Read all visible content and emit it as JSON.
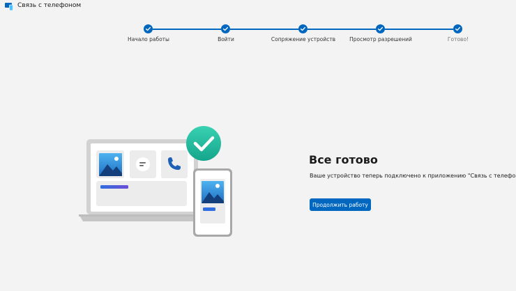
{
  "app": {
    "title": "Связь с телефоном"
  },
  "steps": [
    {
      "label": "Начало работы"
    },
    {
      "label": "Войти"
    },
    {
      "label": "Сопряжение устройств"
    },
    {
      "label": "Просмотр разрешений"
    },
    {
      "label": "Готово!"
    }
  ],
  "main": {
    "heading": "Все готово",
    "description": "Ваше устройство теперь подключено к приложению \"Связь с телефоном\".",
    "continue_label": "Продолжить работу"
  },
  "colors": {
    "accent": "#0067c0",
    "check_circle": "#2fbfa3",
    "background": "#f3f3f3"
  }
}
